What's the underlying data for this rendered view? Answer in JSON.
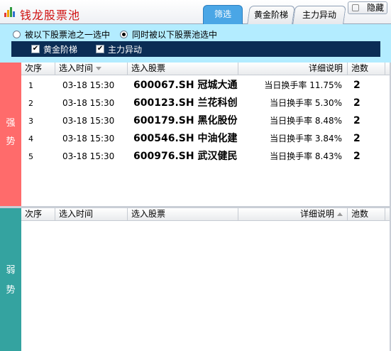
{
  "app": {
    "title": "钱龙股票池",
    "hide_label": "隐藏"
  },
  "tabs": [
    {
      "label": "筛选",
      "active": true
    },
    {
      "label": "黄金阶梯",
      "active": false
    },
    {
      "label": "主力异动",
      "active": false
    }
  ],
  "filter": {
    "radio_any": "被以下股票池之一选中",
    "radio_all": "同时被以下股票池选中",
    "selected_radio": "all",
    "checkboxes": [
      {
        "label": "黄金阶梯",
        "checked": true
      },
      {
        "label": "主力异动",
        "checked": true
      }
    ]
  },
  "columns": {
    "idx": "次序",
    "time": "选入时间",
    "stock": "选入股票",
    "detail": "详细说明",
    "pool": "池数"
  },
  "strong": {
    "side_label": [
      "强",
      "势"
    ],
    "rows": [
      {
        "idx": "1",
        "time": "03-18 15:30",
        "stock": "600067.SH 冠城大通",
        "detail": "当日换手率 11.75%",
        "pool": "2"
      },
      {
        "idx": "2",
        "time": "03-18 15:30",
        "stock": "600123.SH 兰花科创",
        "detail": "当日换手率 5.30%",
        "pool": "2"
      },
      {
        "idx": "3",
        "time": "03-18 15:30",
        "stock": "600179.SH 黑化股份",
        "detail": "当日换手率 8.48%",
        "pool": "2"
      },
      {
        "idx": "4",
        "time": "03-18 15:30",
        "stock": "600546.SH 中油化建",
        "detail": "当日换手率 3.84%",
        "pool": "2"
      },
      {
        "idx": "5",
        "time": "03-18 15:30",
        "stock": "600976.SH 武汉健民",
        "detail": "当日换手率 8.43%",
        "pool": "2"
      }
    ]
  },
  "weak": {
    "side_label": [
      "弱",
      "势"
    ],
    "rows": []
  },
  "colors": {
    "strong_side": "#ff6b6b",
    "weak_side": "#34a3a0",
    "filter_bg": "#b3ecff",
    "cond_bar": "#0b2d55",
    "active_tab": "#4aa6e6",
    "title_red": "#d01010"
  }
}
